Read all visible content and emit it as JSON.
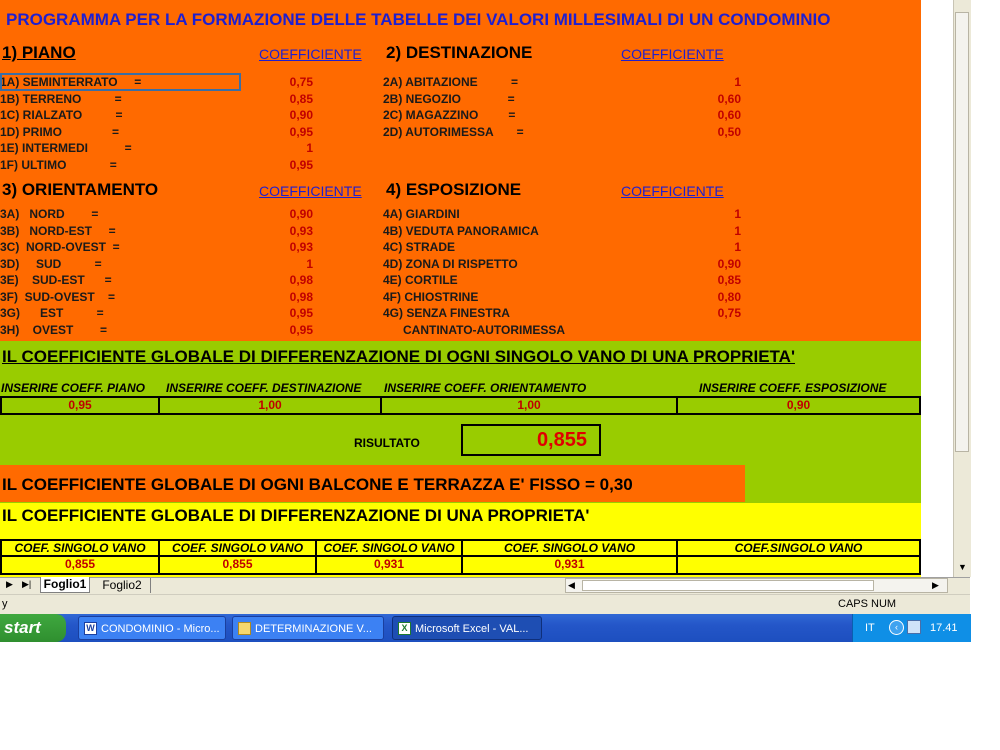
{
  "header": {
    "title": "PROGRAMMA PER LA FORMAZIONE DELLE TABELLE DEI VALORI MILLESIMALI DI UN CONDOMINIO"
  },
  "coef_heading": "COEFFICIENTE",
  "sections": {
    "piano": {
      "title": "1) PIANO",
      "items": [
        {
          "label": "1A) SEMINTERRATO     =",
          "value": "0,75"
        },
        {
          "label": "1B) TERRENO          =",
          "value": "0,85"
        },
        {
          "label": "1C) RIALZATO          =",
          "value": "0,90"
        },
        {
          "label": "1D) PRIMO               =",
          "value": "0,95"
        },
        {
          "label": "1E) INTERMEDI           =",
          "value": "1"
        },
        {
          "label": "1F) ULTIMO             =",
          "value": "0,95"
        }
      ]
    },
    "destinazione": {
      "title": "2) DESTINAZIONE",
      "items": [
        {
          "label": "2A) ABITAZIONE          =",
          "value": "1"
        },
        {
          "label": "2B) NEGOZIO              =",
          "value": "0,60"
        },
        {
          "label": "2C) MAGAZZINO         =",
          "value": "0,60"
        },
        {
          "label": "2D) AUTORIMESSA       =",
          "value": "0,50"
        }
      ]
    },
    "orientamento": {
      "title": "3) ORIENTAMENTO",
      "items": [
        {
          "label": "3A)   NORD        =",
          "value": "0,90"
        },
        {
          "label": "3B)   NORD-EST     =",
          "value": "0,93"
        },
        {
          "label": "3C)  NORD-OVEST  =",
          "value": "0,93"
        },
        {
          "label": "3D)     SUD          =",
          "value": "1"
        },
        {
          "label": "3E)    SUD-EST      =",
          "value": "0,98"
        },
        {
          "label": "3F)  SUD-OVEST    =",
          "value": "0,98"
        },
        {
          "label": "3G)      EST          =",
          "value": "0,95"
        },
        {
          "label": "3H)    OVEST        =",
          "value": "0,95"
        }
      ]
    },
    "esposizione": {
      "title": "4) ESPOSIZIONE",
      "items": [
        {
          "label": "4A) GIARDINI",
          "value": "1"
        },
        {
          "label": "4B) VEDUTA PANORAMICA",
          "value": "1"
        },
        {
          "label": "4C) STRADE",
          "value": "1"
        },
        {
          "label": "4D) ZONA DI RISPETTO",
          "value": "0,90"
        },
        {
          "label": "4E) CORTILE",
          "value": "0,85"
        },
        {
          "label": "4F) CHIOSTRINE",
          "value": "0,80"
        },
        {
          "label": "4G) SENZA FINESTRA",
          "value": "0,75"
        },
        {
          "label": "      CANTINATO-AUTORIMESSA",
          "value": ""
        }
      ]
    }
  },
  "global_vano": {
    "title": "IL COEFFICIENTE GLOBALE DI DIFFERENZAZIONE DI OGNI SINGOLO VANO DI UNA PROPRIETA'",
    "headers": [
      "INSERIRE COEFF. PIANO",
      "INSERIRE COEFF. DESTINAZIONE",
      "INSERIRE COEFF. ORIENTAMENTO",
      "INSERIRE COEFF. ESPOSIZIONE"
    ],
    "values": [
      "0,95",
      "1,00",
      "1,00",
      "0,90"
    ],
    "result_label": "RISULTATO",
    "result_value": "0,855"
  },
  "balcone": {
    "text": "IL COEFFICIENTE GLOBALE DI OGNI BALCONE E TERRAZZA E' FISSO = 0,30"
  },
  "global_proprieta": {
    "title": "IL COEFFICIENTE GLOBALE DI DIFFERENZAZIONE DI UNA PROPRIETA'",
    "headers": [
      "COEF. SINGOLO VANO",
      "COEF. SINGOLO VANO",
      "COEF. SINGOLO VANO",
      "COEF. SINGOLO VANO",
      "COEF.SINGOLO VANO"
    ],
    "values": [
      "0,855",
      "0,855",
      "0,931",
      "0,931",
      ""
    ]
  },
  "sheet_tabs": [
    "Foglio1",
    "Foglio2"
  ],
  "status": {
    "left": "y",
    "right": "CAPS NUM"
  },
  "taskbar": {
    "start": "start",
    "buttons": [
      "CONDOMINIO - Micro...",
      "DETERMINAZIONE V...",
      "Microsoft Excel - VAL..."
    ],
    "lang": "IT",
    "clock": "17.41"
  }
}
